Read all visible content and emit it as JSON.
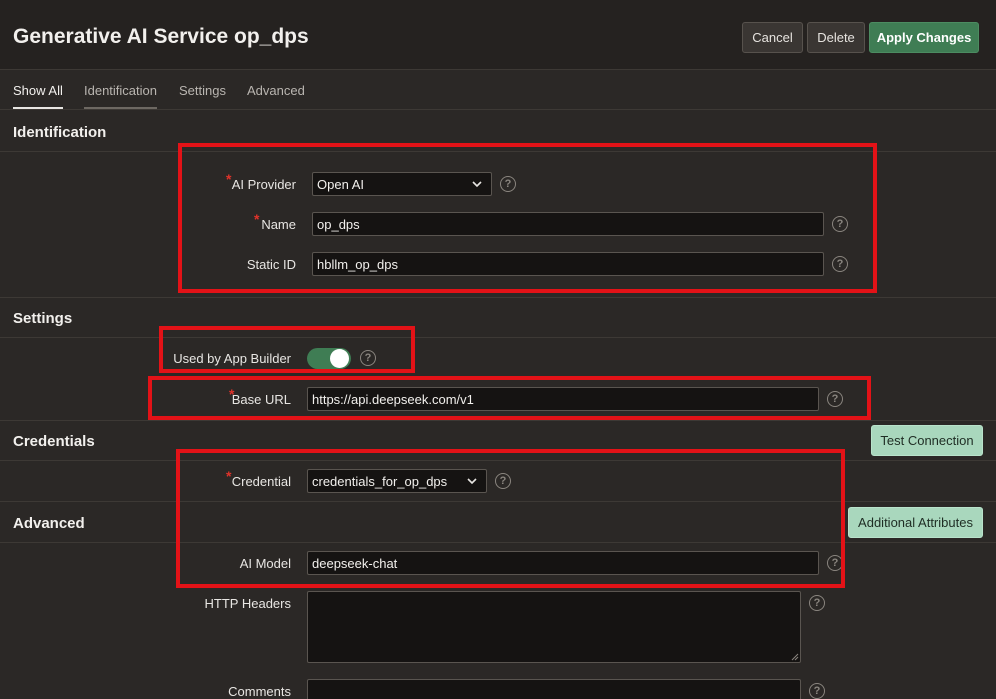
{
  "header": {
    "title": "Generative AI Service op_dps",
    "cancel_label": "Cancel",
    "delete_label": "Delete",
    "apply_label": "Apply Changes"
  },
  "tabs": [
    {
      "label": "Show All",
      "active": true
    },
    {
      "label": "Identification",
      "active": false
    },
    {
      "label": "Settings",
      "active": false
    },
    {
      "label": "Advanced",
      "active": false
    }
  ],
  "sections": {
    "identification": "Identification",
    "settings": "Settings",
    "credentials": "Credentials",
    "advanced": "Advanced"
  },
  "identification": {
    "ai_provider": {
      "label": "AI Provider",
      "value": "Open AI",
      "required": true
    },
    "name": {
      "label": "Name",
      "value": "op_dps",
      "required": true
    },
    "static_id": {
      "label": "Static ID",
      "value": "hbllm_op_dps"
    }
  },
  "settings": {
    "used_by_app_builder": {
      "label": "Used by App Builder",
      "on": true
    },
    "base_url": {
      "label": "Base URL",
      "value": "https://api.deepseek.com/v1",
      "required": true
    }
  },
  "credentials": {
    "test_connection_label": "Test Connection",
    "credential": {
      "label": "Credential",
      "value": "credentials_for_op_dps",
      "required": true
    }
  },
  "advanced": {
    "additional_attributes_label": "Additional Attributes",
    "ai_model": {
      "label": "AI Model",
      "value": "deepseek-chat"
    },
    "http_headers": {
      "label": "HTTP Headers",
      "value": ""
    },
    "comments": {
      "label": "Comments",
      "value": ""
    }
  },
  "help_glyph": "?",
  "required_glyph": "*",
  "colors": {
    "accent_green": "#3f7d54",
    "light_green_button": "#a9d7bd",
    "annotation_red": "#e31217",
    "required_red": "#e0332a"
  }
}
